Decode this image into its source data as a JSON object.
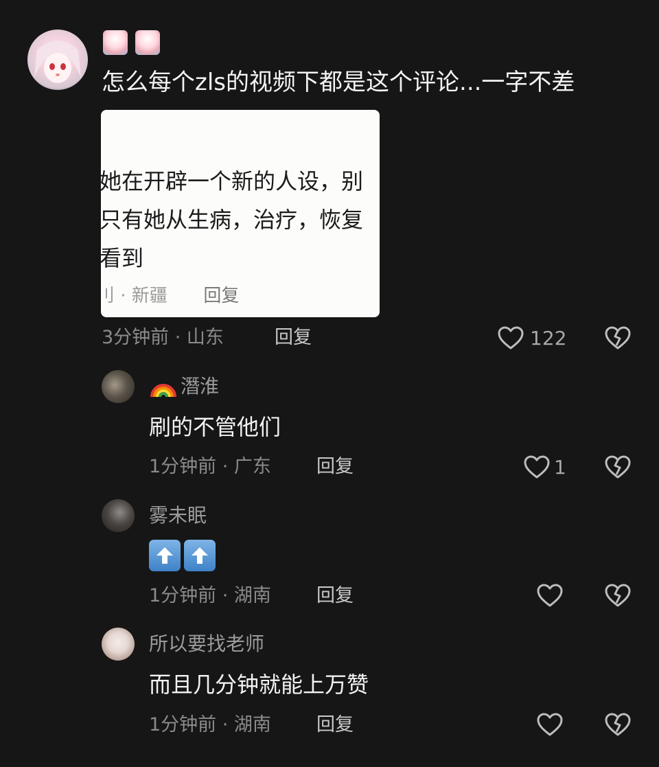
{
  "main_comment": {
    "text": "怎么每个zls的视频下都是这个评论...一字不差",
    "username_emojis": [
      "shaved-ice-emoji",
      "shaved-ice-emoji"
    ],
    "screenshot": {
      "lines": [
        "她在开辟一个新的人设，别",
        "只有她从生病，治疗，恢复",
        "看到"
      ],
      "meta": "刂 · 新疆",
      "reply_label": "回复"
    },
    "time_location": "3分钟前 · 山东",
    "reply_label": "回复",
    "like_count": "122"
  },
  "replies": [
    {
      "username": "潛淮",
      "username_prefix_icon": "rainbow-emoji",
      "text": "刷的不管他们",
      "time_location": "1分钟前 · 广东",
      "reply_label": "回复",
      "like_count": "1"
    },
    {
      "username": "雾未眠",
      "text_icons": [
        "up-arrow-emoji",
        "up-arrow-emoji"
      ],
      "time_location": "1分钟前 · 湖南",
      "reply_label": "回复",
      "like_count": ""
    },
    {
      "username": "所以要找老师",
      "text": "而且几分钟就能上万赞",
      "time_location": "1分钟前 · 湖南",
      "reply_label": "回复",
      "like_count": ""
    }
  ],
  "colors": {
    "background": "#161616",
    "primary_text": "#f3f3f3",
    "secondary_text": "#8b8b8b",
    "icon": "#bdbdbd"
  }
}
